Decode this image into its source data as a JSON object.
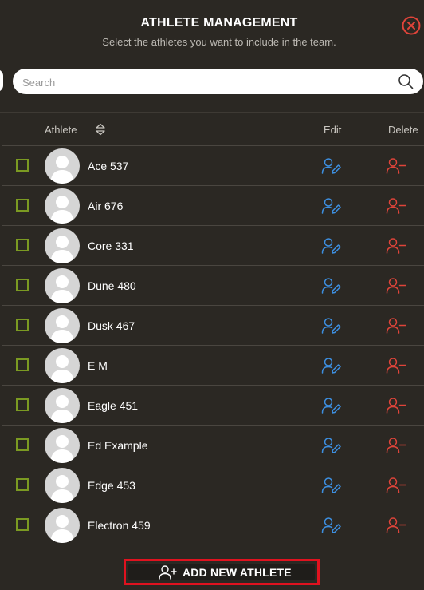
{
  "header": {
    "title": "ATHLETE MANAGEMENT",
    "subtitle": "Select the athletes you want to include in the team.",
    "close_icon": "close-circle-icon"
  },
  "search": {
    "placeholder": "Search",
    "value": "",
    "icon": "search-icon"
  },
  "table": {
    "columns": {
      "athlete": "Athlete",
      "edit": "Edit",
      "delete": "Delete"
    },
    "sort_icon": "sort-updown-icon",
    "rows": [
      {
        "name": "Ace 537",
        "selected": false
      },
      {
        "name": "Air 676",
        "selected": false
      },
      {
        "name": "Core 331",
        "selected": false
      },
      {
        "name": "Dune 480",
        "selected": false
      },
      {
        "name": "Dusk 467",
        "selected": false
      },
      {
        "name": "E M",
        "selected": false
      },
      {
        "name": "Eagle 451",
        "selected": false
      },
      {
        "name": "Ed Example",
        "selected": false
      },
      {
        "name": "Edge 453",
        "selected": false
      },
      {
        "name": "Electron 459",
        "selected": false
      }
    ]
  },
  "footer": {
    "add_button_label": "ADD NEW ATHLETE",
    "add_icon": "user-plus-icon"
  },
  "colors": {
    "background": "#2b2823",
    "checkbox": "#7b9a22",
    "edit": "#3d8fe0",
    "delete": "#e0443a",
    "highlight": "#e0121f"
  }
}
